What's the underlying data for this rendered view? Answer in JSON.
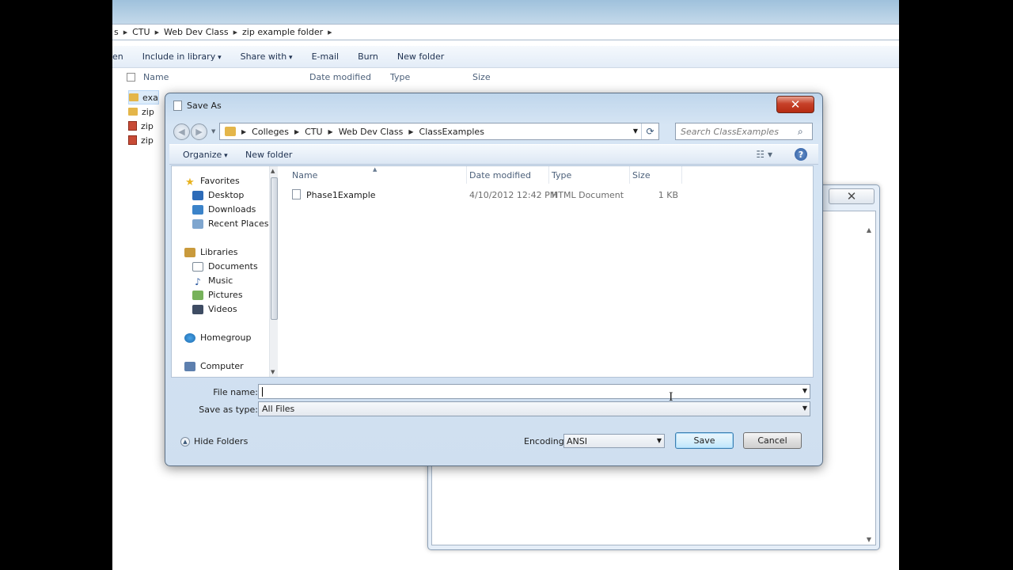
{
  "background_explorer": {
    "breadcrumb": [
      "s",
      "CTU",
      "Web Dev Class",
      "zip example folder"
    ],
    "toolbar": {
      "open_fragment": "en",
      "include_in_library": "Include in library",
      "share_with": "Share with",
      "email": "E-mail",
      "burn": "Burn",
      "new_folder": "New folder"
    },
    "columns": [
      "Name",
      "Date modified",
      "Type",
      "Size"
    ],
    "rows": [
      "exa",
      "zip",
      "zip",
      "zip"
    ]
  },
  "dialog": {
    "title": "Save As",
    "close_glyph": "✕",
    "address": {
      "crumbs": [
        "Colleges",
        "CTU",
        "Web Dev Class",
        "ClassExamples"
      ]
    },
    "search": {
      "placeholder": "Search ClassExamples"
    },
    "commands": {
      "organize": "Organize",
      "new_folder": "New folder",
      "help": "?"
    },
    "nav": {
      "favorites": "Favorites",
      "desktop": "Desktop",
      "downloads": "Downloads",
      "recent_places": "Recent Places",
      "libraries": "Libraries",
      "documents": "Documents",
      "music": "Music",
      "pictures": "Pictures",
      "videos": "Videos",
      "homegroup": "Homegroup",
      "computer": "Computer"
    },
    "columns": {
      "name": "Name",
      "date": "Date modified",
      "type": "Type",
      "size": "Size"
    },
    "files": [
      {
        "name": "Phase1Example",
        "date": "4/10/2012 12:42 PM",
        "type": "HTML Document",
        "size": "1 KB"
      }
    ],
    "form": {
      "file_name_label": "File name:",
      "file_name_value": "",
      "save_as_type_label": "Save as type:",
      "save_as_type_value": "All Files"
    },
    "footer": {
      "hide_folders": "Hide Folders",
      "encoding_label": "Encoding:",
      "encoding_value": "ANSI",
      "save": "Save",
      "cancel": "Cancel"
    }
  },
  "notepad_window": {
    "close_glyph": "✕"
  },
  "colors": {
    "dialog_frame": "#cfdff0",
    "close_red": "#c74129",
    "save_blue": "#bee6fd"
  }
}
